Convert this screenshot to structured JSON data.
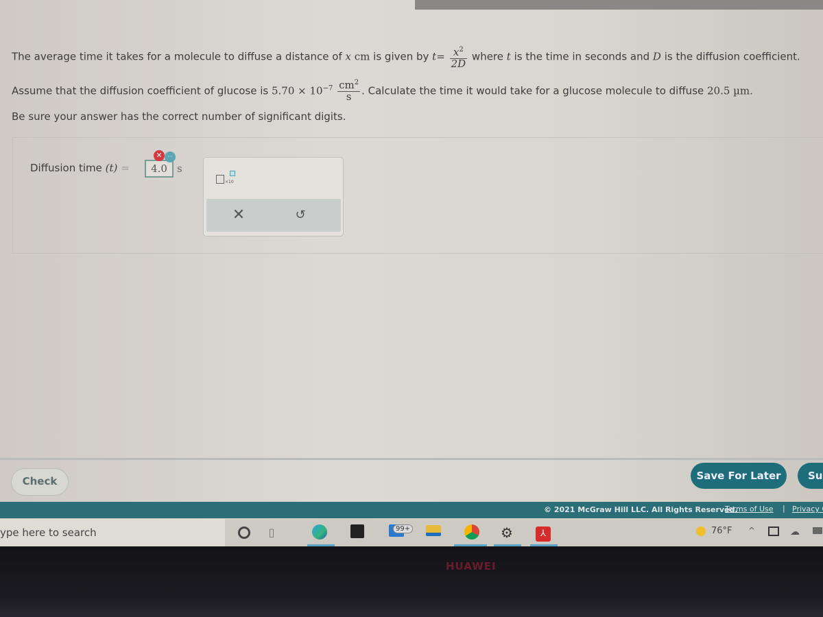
{
  "question": {
    "line1_prefix": "The average time it takes for a molecule to diffuse a distance of",
    "line1_var_x": "x",
    "line1_unit": "cm",
    "line1_given": "is given by",
    "formula_lhs": "t",
    "formula_eq": "=",
    "formula_num": "x",
    "formula_num_exp": "2",
    "formula_den": "2D",
    "line1_suffix_a": "where",
    "line1_suffix_t": "t",
    "line1_suffix_b": "is the time in seconds and",
    "line1_suffix_D": "D",
    "line1_suffix_c": "is the diffusion coefficient.",
    "line2_prefix": "Assume that the diffusion coefficient of glucose is",
    "coef_value": "5.70 × 10",
    "coef_exp": "−7",
    "unit_num": "cm",
    "unit_num_exp": "2",
    "unit_den": "s",
    "line2_suffix": ". Calculate the time it would take for a glucose molecule to diffuse",
    "distance": "20.5 µm",
    "period": ".",
    "line3": "Be sure your answer has the correct number of significant digits."
  },
  "answer": {
    "label_prefix": "Diffusion time",
    "label_var": "(t)",
    "label_eq": "=",
    "value": "4.0",
    "unit": "s",
    "wrong_badge": "✕",
    "more_badge": "···"
  },
  "keypad": {
    "sci_notation_label": "×10",
    "clear_symbol": "✕",
    "undo_symbol": "↺"
  },
  "actions": {
    "check_label": "Check",
    "save_label": "Save For Later",
    "submit_label": "Submit"
  },
  "footer": {
    "copyright": "© 2021 McGraw Hill LLC. All Rights Reserved.",
    "terms": "Terms of Use",
    "separator": "|",
    "privacy": "Privacy Center"
  },
  "taskbar": {
    "search_placeholder": "ype here to search",
    "mail_badge": "99+",
    "weather": "76°F",
    "pdf_icon": "⅄",
    "settings_icon": "⚙",
    "tray_up": "^",
    "tray_cloud": "☁"
  },
  "bezel": {
    "brand": "HUAWEI"
  }
}
